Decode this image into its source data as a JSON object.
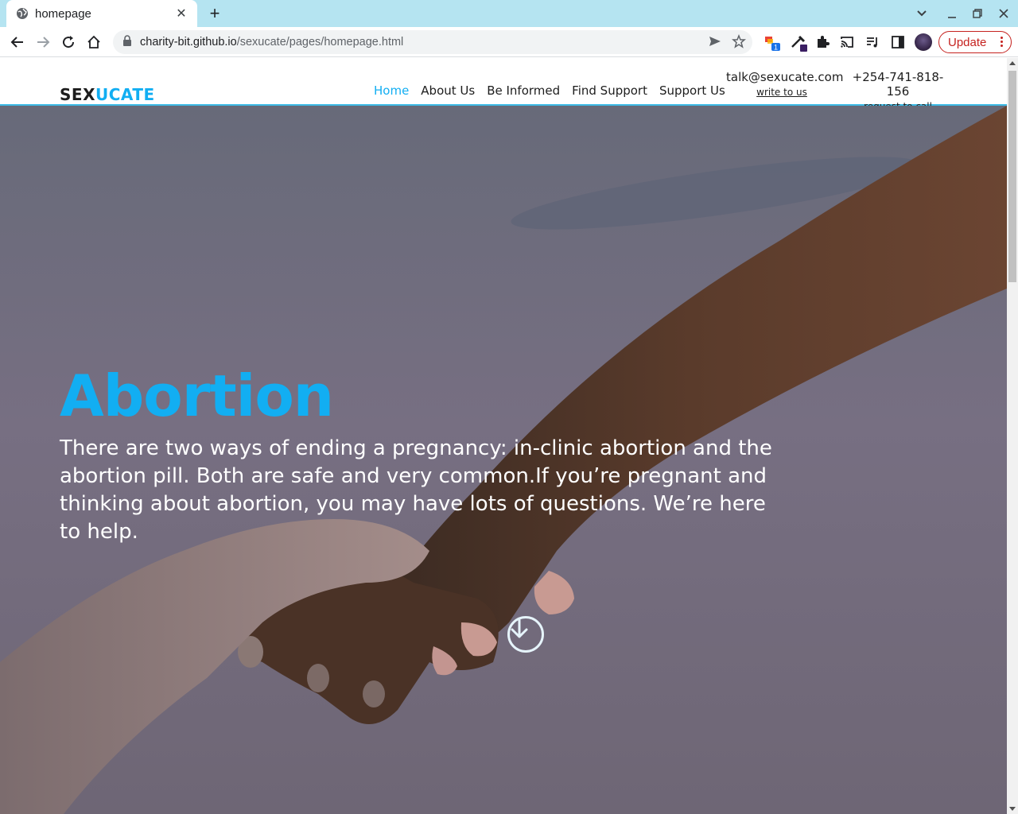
{
  "browser": {
    "tab_title": "homepage",
    "url_host": "charity-bit.github.io",
    "url_path": "/sexucate/pages/homepage.html",
    "update_label": "Update",
    "extension_badge": "1"
  },
  "site": {
    "logo_part1": "SEX",
    "logo_part2": "UCATE",
    "nav": {
      "home": "Home",
      "about": "About Us",
      "informed": "Be Informed",
      "support_find": "Find Support",
      "support_us": "Support Us"
    },
    "email": "talk@sexucate.com",
    "email_link": "write to us",
    "phone": "+254-741-818-156",
    "phone_link": "request to call",
    "colors": {
      "accent": "#12aef2",
      "header_border": "#3dbbe6"
    }
  },
  "hero": {
    "title": "Abortion",
    "text": "There are two ways of ending a pregnancy: in-clinic abortion and the abortion pill. Both are safe and very common.If you’re pregnant and thinking about abortion, you may have lots of questions. We’re here to help."
  }
}
